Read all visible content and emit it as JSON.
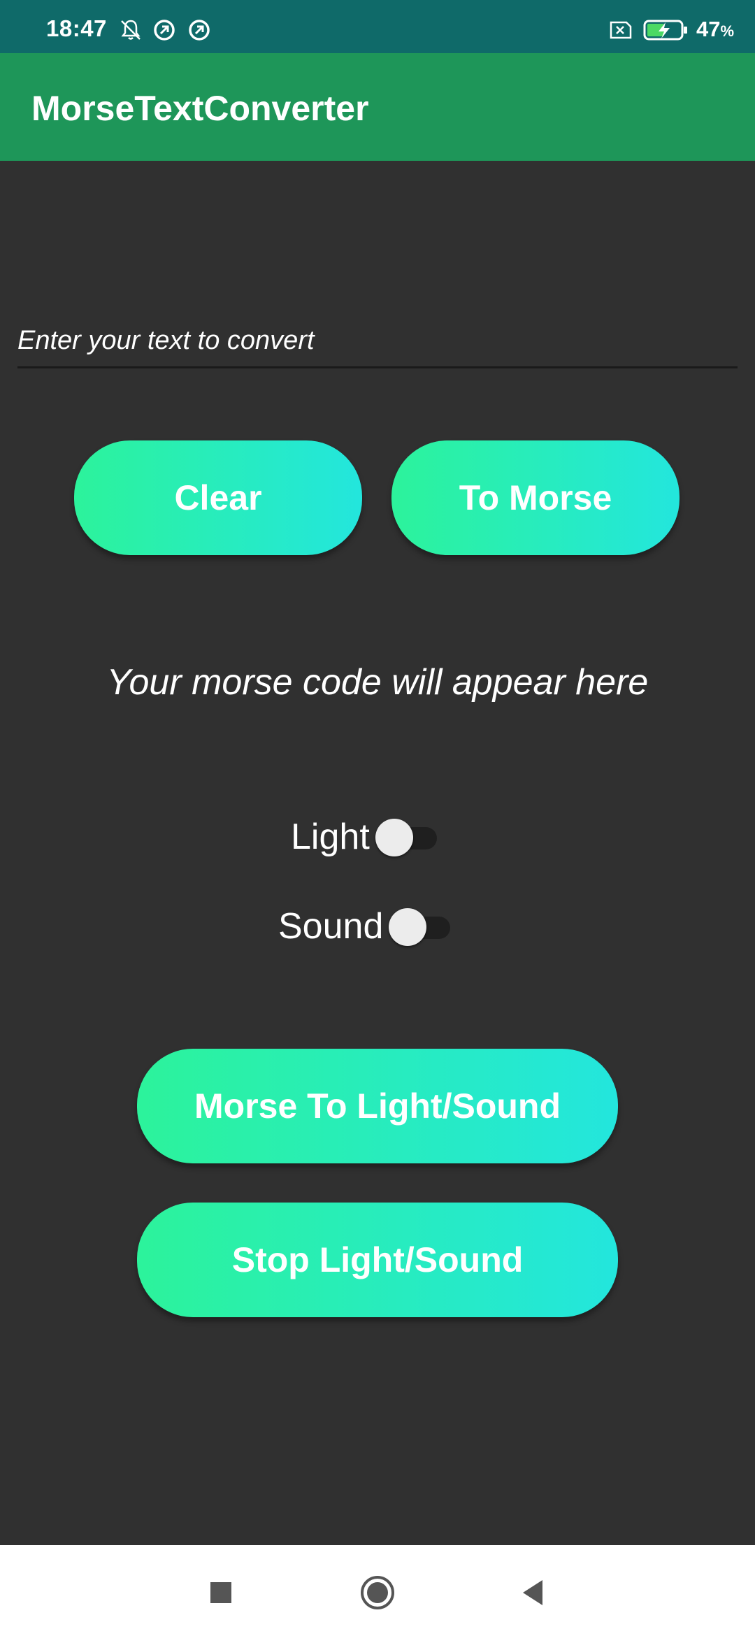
{
  "status_bar": {
    "time": "18:47",
    "battery_percent": "47",
    "battery_unit": "%",
    "icons": [
      "bell-muted-icon",
      "data-saver-icon",
      "data-saver-icon",
      "sim-off-icon",
      "battery-charging-icon"
    ]
  },
  "app_bar": {
    "title": "MorseTextConverter"
  },
  "input": {
    "placeholder": "Enter your text to convert",
    "value": ""
  },
  "buttons": {
    "clear": "Clear",
    "to_morse": "To Morse",
    "morse_to_light_sound": "Morse To Light/Sound",
    "stop_light_sound": "Stop Light/Sound"
  },
  "output": {
    "morse_text": "Your morse code will appear here"
  },
  "switches": {
    "light": {
      "label": "Light",
      "checked": false
    },
    "sound": {
      "label": "Sound",
      "checked": false
    }
  },
  "nav_bar": {
    "icons": [
      "recent-apps-icon",
      "home-icon",
      "back-icon"
    ]
  },
  "colors": {
    "status_bar": "#0f6a69",
    "app_bar": "#1e9659",
    "background": "#303030",
    "button_gradient_start": "#2cf39b",
    "button_gradient_end": "#23e6dd",
    "nav_bar": "#ffffff"
  }
}
